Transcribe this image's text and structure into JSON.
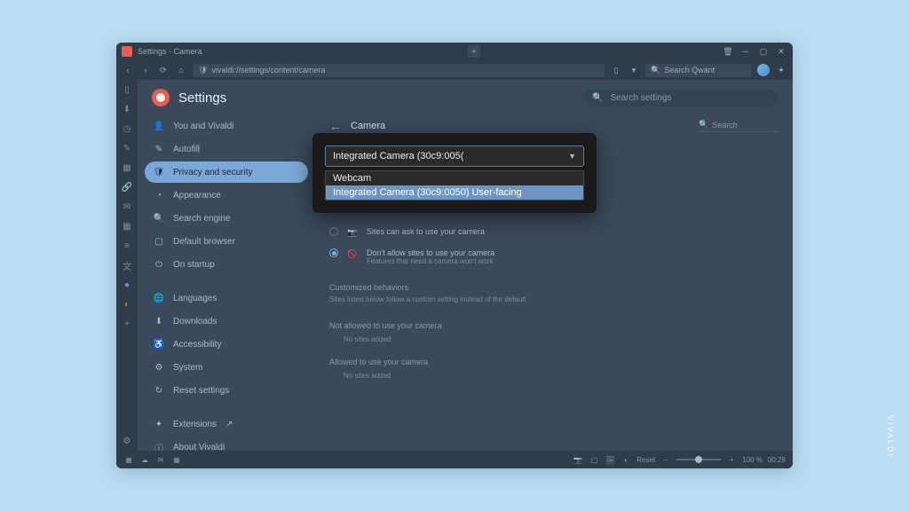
{
  "titlebar": {
    "title": "Settings - Camera"
  },
  "addressbar": {
    "url": "vivaldi://settings/content/camera",
    "search_placeholder": "Search Qwant"
  },
  "settings": {
    "title": "Settings",
    "search_placeholder": "Search settings",
    "section": {
      "title": "Camera",
      "search_placeholder": "Search",
      "radio_ask": "Sites can ask to use your camera",
      "radio_block_title": "Don't allow sites to use your camera",
      "radio_block_sub": "Features that need a camera won't work",
      "customized_label": "Customized behaviors",
      "customized_desc": "Sites listed below follow a custom setting instead of the default",
      "not_allowed_label": "Not allowed to use your camera",
      "allowed_label": "Allowed to use your camera",
      "empty": "No sites added"
    }
  },
  "sidebar": {
    "items": [
      {
        "label": "You and Vivaldi",
        "icon": "person-icon"
      },
      {
        "label": "Autofill",
        "icon": "autofill-icon"
      },
      {
        "label": "Privacy and security",
        "icon": "shield-icon",
        "active": true
      },
      {
        "label": "Appearance",
        "icon": "appearance-icon"
      },
      {
        "label": "Search engine",
        "icon": "search-icon"
      },
      {
        "label": "Default browser",
        "icon": "browser-icon"
      },
      {
        "label": "On startup",
        "icon": "power-icon"
      }
    ],
    "items2": [
      {
        "label": "Languages",
        "icon": "globe-icon"
      },
      {
        "label": "Downloads",
        "icon": "download-icon"
      },
      {
        "label": "Accessibility",
        "icon": "accessibility-icon"
      },
      {
        "label": "System",
        "icon": "system-icon"
      },
      {
        "label": "Reset settings",
        "icon": "reset-icon"
      }
    ],
    "items3": [
      {
        "label": "Extensions",
        "icon": "puzzle-icon",
        "external": true
      },
      {
        "label": "About Vivaldi",
        "icon": "info-icon"
      }
    ]
  },
  "dropdown": {
    "selected": "Integrated Camera (30c9:005(",
    "options": [
      {
        "label": "Webcam",
        "highlighted": false
      },
      {
        "label": "Integrated Camera (30c9:0050) User-facing",
        "highlighted": true
      }
    ]
  },
  "statusbar": {
    "reset": "Reset",
    "zoom": "100 %",
    "time": "00:29"
  },
  "watermark": "VIVALDI"
}
